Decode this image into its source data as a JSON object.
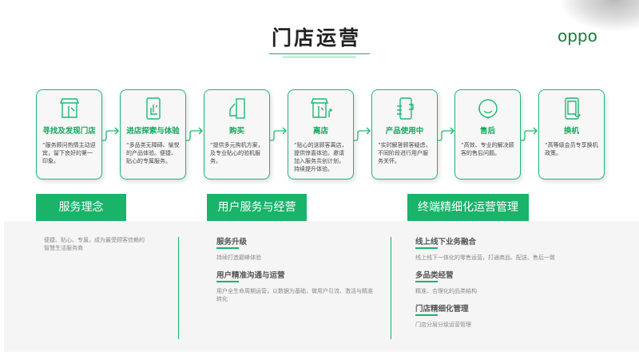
{
  "title": "门店运营",
  "logo": "oppo",
  "colors": {
    "accent": "#19b46a",
    "logo": "#1a7a3a"
  },
  "steps": [
    {
      "title": "寻找及发现门店",
      "icon": "storefront-icon",
      "desc": "“服务顾问热情主动迎宾，留下良好的第一印象。"
    },
    {
      "title": "进店探索与体验",
      "icon": "touch-phone-icon",
      "desc": "“多品类无障碍、愉悦的产品体验。便捷、贴心的专属服务。"
    },
    {
      "title": "购买",
      "icon": "card-payment-icon",
      "desc": "“提供多元购机方案，及专业贴心的验机服务。"
    },
    {
      "title": "离店",
      "icon": "store-exit-icon",
      "desc": "“贴心的送顾客离店，提供惊喜体验。邀请加入服务共创计划，持续提升体验。"
    },
    {
      "title": "产品使用中",
      "icon": "phone-in-hand-icon",
      "desc": "“实时解答顾客疑虑，不同阶段进行用户服务关怀。"
    },
    {
      "title": "售后",
      "icon": "headset-icon",
      "desc": "“高效、专业的解决顾客的售后问题。"
    },
    {
      "title": "换机",
      "icon": "phone-swap-icon",
      "desc": "“高等级会员专享换机政策。"
    }
  ],
  "sections": {
    "philosophy": {
      "label": "服务理念",
      "text": "便捷、贴心、专属，成为最受顾客信赖的智慧生活服务商"
    },
    "user_service": {
      "label": "用户服务与经营",
      "items": [
        {
          "title": "服务升级",
          "text": "持续打造巅峰体验"
        },
        {
          "title": "用户精准沟通与运营",
          "text": "用户全生命周期运营，以数据为基础，做用户引流、激活与精准转化"
        }
      ]
    },
    "terminal": {
      "label": "终端精细化运营管理",
      "items": [
        {
          "title": "线上线下业务融合",
          "text": "线上线下一体化的零售运营，打通商品、配送、售后一致"
        },
        {
          "title": "多品类经营",
          "text": "精准、合理化的品类结构"
        },
        {
          "title": "门店精细化管理",
          "text": "门店分层分级运营管理"
        }
      ]
    }
  }
}
